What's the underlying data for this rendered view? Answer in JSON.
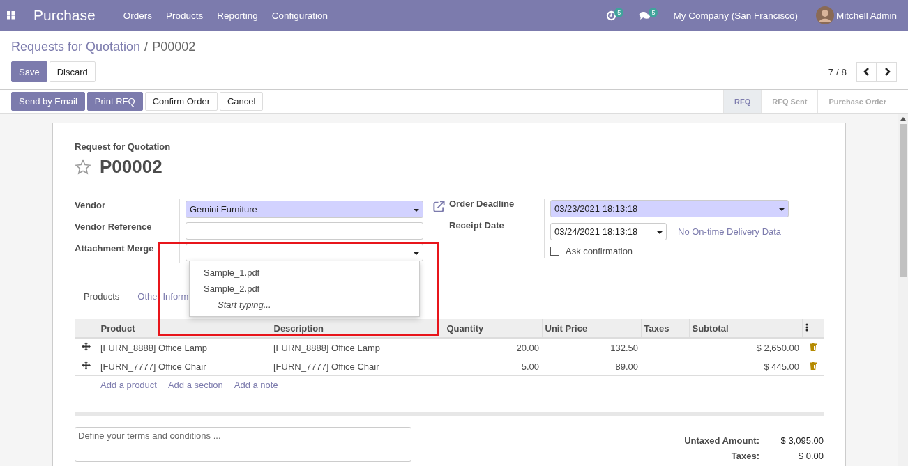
{
  "navbar": {
    "app_name": "Purchase",
    "menus": [
      "Orders",
      "Products",
      "Reporting",
      "Configuration"
    ],
    "activity_count": "5",
    "message_count": "5",
    "company": "My Company (San Francisco)",
    "user": "Mitchell Admin"
  },
  "breadcrumb": {
    "parent": "Requests for Quotation",
    "separator": "/",
    "current": "P00002"
  },
  "edit_buttons": [
    {
      "label": "Save",
      "kind": "primary"
    },
    {
      "label": "Discard",
      "kind": "secondary"
    }
  ],
  "pager": "7 / 8",
  "action_buttons": [
    {
      "label": "Send by Email",
      "kind": "primary"
    },
    {
      "label": "Print RFQ",
      "kind": "primary"
    },
    {
      "label": "Confirm Order",
      "kind": "secondary"
    },
    {
      "label": "Cancel",
      "kind": "secondary"
    }
  ],
  "stages": [
    {
      "label": "RFQ",
      "selected": true
    },
    {
      "label": "RFQ Sent",
      "selected": false
    },
    {
      "label": "Purchase Order",
      "selected": false
    }
  ],
  "form": {
    "subtitle": "Request for Quotation",
    "name": "P00002",
    "starred": false,
    "left_fields": [
      {
        "label": "Vendor",
        "kind": "select",
        "value": "Gemini Furniture",
        "required": true
      },
      {
        "label": "Vendor Reference",
        "kind": "text",
        "required": false
      },
      {
        "label": "Attachment Merge",
        "kind": "select",
        "required": false,
        "open": true
      }
    ],
    "dropdown": {
      "options": [
        "Sample_1.pdf",
        "Sample_2.pdf"
      ],
      "hint": "Start typing..."
    },
    "order_deadline": {
      "label": "Order Deadline",
      "value": "03/23/2021 18:13:18",
      "required": true
    },
    "receipt_date": {
      "label": "Receipt Date",
      "value": "03/24/2021 18:13:18",
      "note": "No On-time Delivery Data"
    },
    "ask_confirmation": {
      "label": "Ask confirmation",
      "checked": false
    }
  },
  "tabs": [
    {
      "label": "Products",
      "selected": true
    },
    {
      "label": "Other Inform",
      "selected": false
    }
  ],
  "table": {
    "columns": [
      "Product",
      "Description",
      "Quantity",
      "Unit Price",
      "Taxes",
      "Subtotal"
    ],
    "rows": [
      {
        "product": "[FURN_8888] Office Lamp",
        "description": "[FURN_8888] Office Lamp",
        "quantity": "20.00",
        "unit_price": "132.50",
        "subtotal": "$ 2,650.00"
      },
      {
        "product": "[FURN_7777] Office Chair",
        "description": "[FURN_7777] Office Chair",
        "quantity": "5.00",
        "unit_price": "89.00",
        "subtotal": "$ 445.00"
      }
    ],
    "add_links": [
      "Add a product",
      "Add a section",
      "Add a note"
    ]
  },
  "notes": {
    "placeholder": "Define your terms and conditions ..."
  },
  "totals": [
    {
      "label": "Untaxed Amount:",
      "value": "$ 3,095.00"
    },
    {
      "label": "Taxes:",
      "value": "$ 0.00"
    }
  ]
}
